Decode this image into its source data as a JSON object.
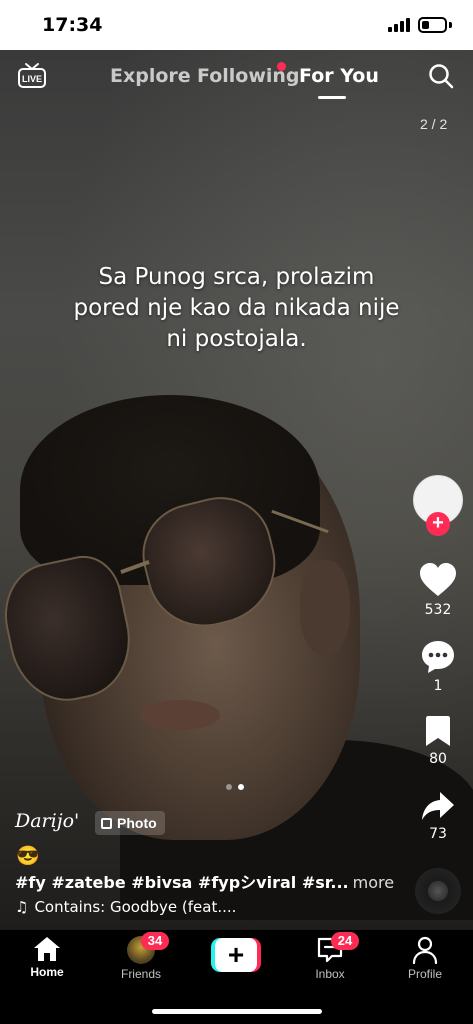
{
  "status_bar": {
    "time": "17:34",
    "battery_level": 0.35
  },
  "top_nav": {
    "tabs": [
      {
        "label": "Explore"
      },
      {
        "label": "Following"
      },
      {
        "label": "For You"
      }
    ],
    "active_tab": "For You",
    "live_icon": "live-tv-icon",
    "search_icon": "search-icon"
  },
  "post": {
    "photo_counter": "2 / 2",
    "overlay_lines": [
      "Sa Punog srca, prolazim",
      "pored nje kao da nikada nije",
      "ni postojala."
    ],
    "username": "Darijo'",
    "badge_label": "Photo",
    "emoji": "😎",
    "hashtags": "#fy #zatebe #bivsa #fypシviral #sr...",
    "more_label": "more",
    "music": "Contains: Goodbye (feat....",
    "carousel": {
      "total": 2,
      "current": 2
    }
  },
  "actions": {
    "likes": "532",
    "comments": "1",
    "saves": "80",
    "shares": "73"
  },
  "bottom_nav": {
    "tabs": [
      {
        "label": "Home"
      },
      {
        "label": "Friends",
        "badge": "34"
      },
      {
        "label": ""
      },
      {
        "label": "Inbox",
        "badge": "24"
      },
      {
        "label": "Profile"
      }
    ]
  },
  "colors": {
    "accent": "#fe2c55",
    "cyan": "#25f4ee",
    "background": "#000000"
  }
}
